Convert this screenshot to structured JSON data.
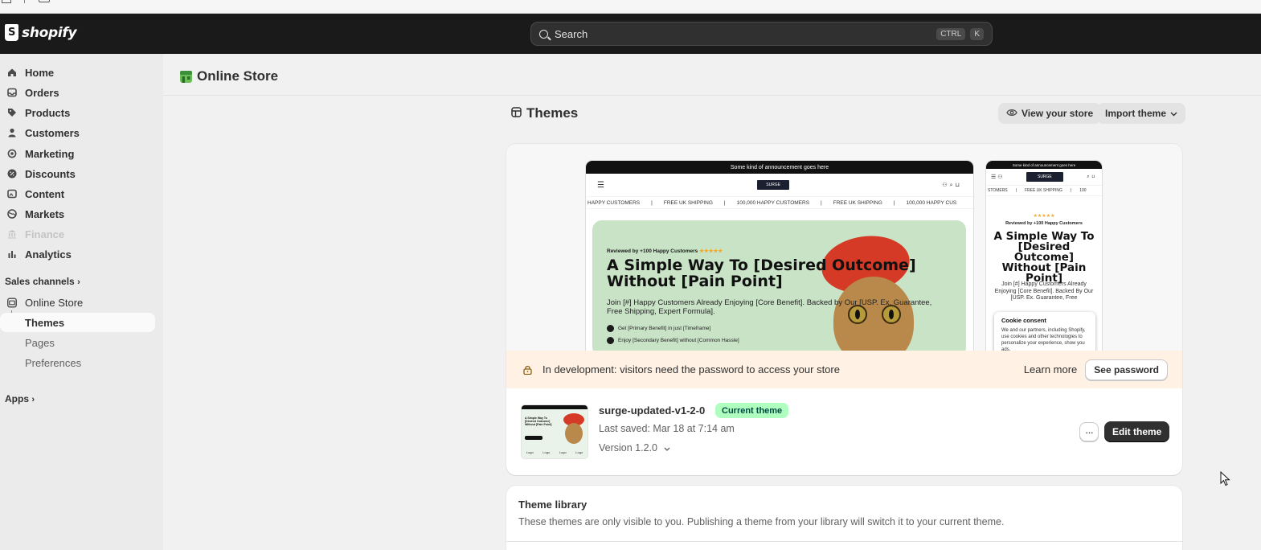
{
  "brand": {
    "name": "shopify"
  },
  "search": {
    "placeholder": "Search",
    "shortcut_keys": [
      "CTRL",
      "K"
    ]
  },
  "sidebar": {
    "items": [
      {
        "label": "Home",
        "icon": "home-icon"
      },
      {
        "label": "Orders",
        "icon": "inbox-icon"
      },
      {
        "label": "Products",
        "icon": "tag-icon"
      },
      {
        "label": "Customers",
        "icon": "person-icon"
      },
      {
        "label": "Marketing",
        "icon": "target-icon"
      },
      {
        "label": "Discounts",
        "icon": "discount-icon"
      },
      {
        "label": "Content",
        "icon": "image-icon"
      },
      {
        "label": "Markets",
        "icon": "globe-icon"
      },
      {
        "label": "Finance",
        "icon": "bank-icon",
        "disabled": true
      },
      {
        "label": "Analytics",
        "icon": "bar-chart-icon"
      }
    ],
    "sales_channels_label": "Sales channels",
    "online_store_label": "Online Store",
    "sub_items": [
      "Themes",
      "Pages",
      "Preferences"
    ],
    "apps_label": "Apps"
  },
  "page": {
    "title": "Online Store"
  },
  "themes": {
    "title": "Themes",
    "view_store_label": "View your store",
    "import_label": "Import theme"
  },
  "preview": {
    "announcement": "Some kind of announcement goes here",
    "ticker": [
      "HAPPY CUSTOMERS",
      "|",
      "FREE UK SHIPPING",
      "|",
      "100,000 HAPPY CUSTOMERS",
      "|",
      "FREE UK SHIPPING",
      "|",
      "100,000 HAPPY CUS"
    ],
    "mobile_ticker": [
      "STOMERS",
      "|",
      "FREE UK SHIPPING",
      "|",
      "100"
    ],
    "logo_text": "SURGE",
    "reviewed": "Reviewed by +100 Happy Customers",
    "stars": "★★★★★",
    "headline": "A Simple Way To [Desired Outcome] Without [Pain Point]",
    "subtext": "Join [#] Happy Customers Already Enjoying [Core Benefit]. Backed by Our [USP. Ex. Guarantee, Free Shipping, Expert Formula].",
    "mobile_subtext": "Join [#] Happy Customers Already Enjoying [Core Benefit]. Backed By Our [USP. Ex. Guarantee, Free",
    "benefits": [
      "Get [Primary Benefit] in just [Timeframe]",
      "Enjoy [Secondary Benefit] without [Common Hassle]"
    ],
    "cookie_title": "Cookie consent",
    "cookie_text": "We and our partners, including Shopify, use cookies and other technologies to personalize your experience, show you ads,"
  },
  "banner": {
    "text": "In development: visitors need the password to access your store",
    "learn_more": "Learn more",
    "button": "See password"
  },
  "current_theme": {
    "name": "surge-updated-v1-2-0",
    "badge": "Current theme",
    "saved": "Last saved: Mar 18 at 7:14 am",
    "version": "Version 1.2.0",
    "more_label": "···",
    "edit_label": "Edit theme",
    "thumb_labels": [
      "Logo",
      "Logo",
      "Logo",
      "Logo"
    ]
  },
  "library": {
    "title": "Theme library",
    "description": "These themes are only visible to you. Publishing a theme from your library will switch it to your current theme."
  },
  "colors": {
    "header_bg": "#1a1a1a",
    "sidebar_bg": "#ebebeb",
    "banner_bg": "#fff1e3",
    "badge_bg": "#affebf",
    "primary_btn": "#303030"
  }
}
